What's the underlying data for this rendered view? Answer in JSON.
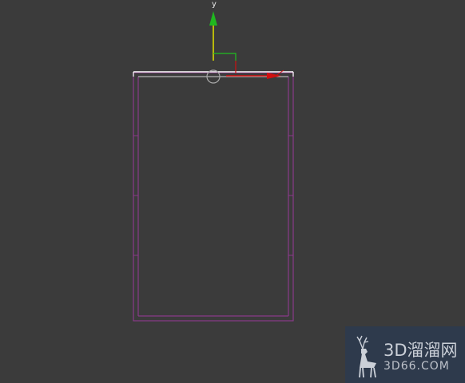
{
  "viewport": {
    "background": "#3b3b3b",
    "axis_y_label": "y"
  },
  "gizmo": {
    "y_axis_color": "#1fb81f",
    "y_axis_shaft_color": "#d8d800",
    "x_axis_color": "#d01010",
    "plane_color": "#20c020"
  },
  "object": {
    "outline_color": "#8a3a8a",
    "selected_edge_color": "#ffffff"
  },
  "watermark": {
    "title": "3D溜溜网",
    "subtitle": "3D66.COM",
    "background": "#2d3a4e",
    "logo_icon": "deer-icon"
  }
}
